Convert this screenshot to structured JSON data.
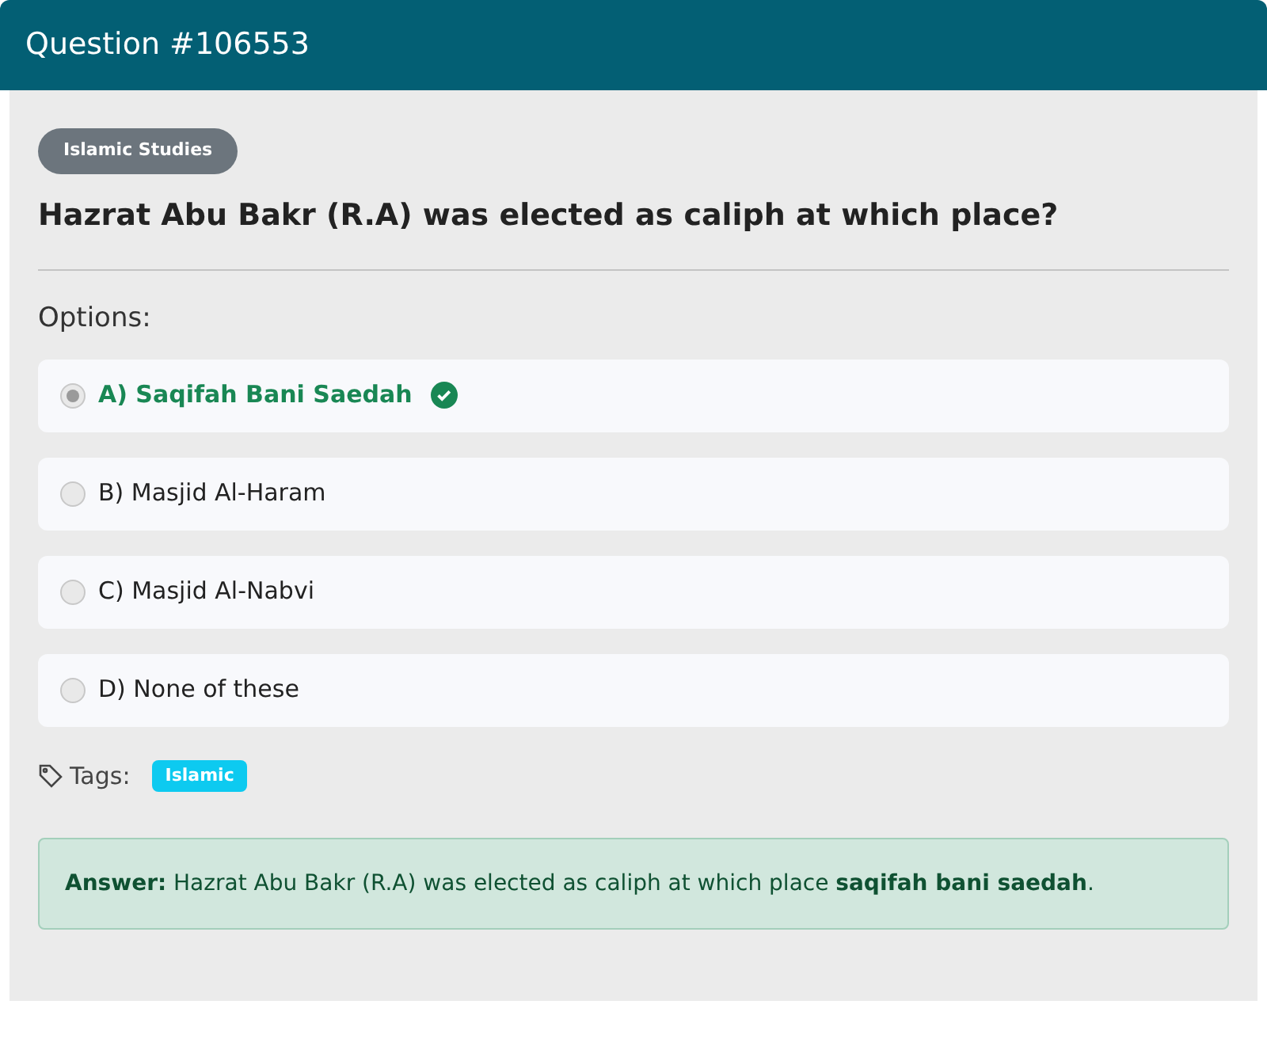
{
  "header": {
    "title": "Question #106553"
  },
  "category": "Islamic Studies",
  "question": "Hazrat Abu Bakr (R.A) was elected as caliph at which place?",
  "options_label": "Options:",
  "options": [
    {
      "label": "A) Saqifah Bani Saedah",
      "selected": true,
      "correct": true
    },
    {
      "label": "B) Masjid Al-Haram",
      "selected": false,
      "correct": false
    },
    {
      "label": "C) Masjid Al-Nabvi",
      "selected": false,
      "correct": false
    },
    {
      "label": "D) None of these",
      "selected": false,
      "correct": false
    }
  ],
  "tags_label": "Tags:",
  "tags": [
    "Islamic"
  ],
  "answer": "**Answer:** Hazrat Abu Bakr (R.A) was elected as caliph at which place **saqifah bani saedah**."
}
